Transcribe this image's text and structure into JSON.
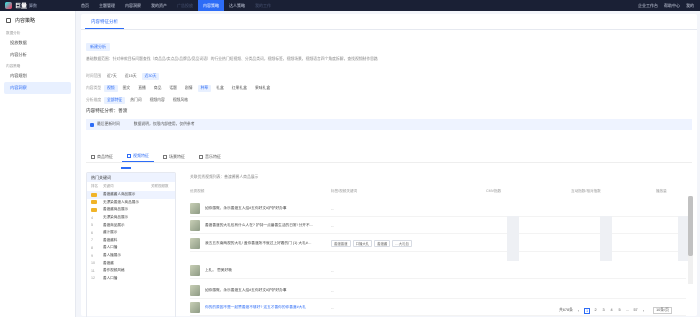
{
  "app": {
    "name": "巨量",
    "sub": "算数"
  },
  "topnav": [
    {
      "label": "首页",
      "active": false
    },
    {
      "label": "主题管理",
      "active": false
    },
    {
      "label": "内容洞察",
      "active": false
    },
    {
      "label": "我的资产",
      "active": false
    },
    {
      "label": "广告投放",
      "active": false,
      "dim": true
    },
    {
      "label": "内容策略",
      "active": true
    },
    {
      "label": "达人策略",
      "active": false
    },
    {
      "label": "我的工作",
      "active": false,
      "dim": true
    }
  ],
  "topright": [
    "企业工作台",
    "帮助中心",
    "我的"
  ],
  "sidebar": {
    "header": "内容策略",
    "groups": [
      {
        "label": "数据分析",
        "items": [
          {
            "label": "投放数据",
            "active": false
          },
          {
            "label": "内容分析",
            "active": false
          }
        ]
      },
      {
        "label": "内容策略",
        "items": [
          {
            "label": "内容规划",
            "active": false
          },
          {
            "label": "内容洞察",
            "active": true
          }
        ]
      }
    ]
  },
  "main_tabs": [
    {
      "label": "内容特征分析",
      "active": true
    }
  ],
  "action_button": "新建分析",
  "description": "基础数据范围：针对单款目标问题查找（商品品/卖点品/品牌品/竞品词语）的行业热门短视频、分类品类词，视频标签，视频场景，视频语言四个角度拆解，查找视频制作思路",
  "filters": [
    {
      "label": "时间范围",
      "chips": [
        {
          "t": "近7天",
          "on": false
        },
        {
          "t": "近15天",
          "on": false
        },
        {
          "t": "近30天",
          "on": true
        }
      ]
    },
    {
      "label": "内容类型",
      "chips": [
        {
          "t": "视频",
          "on": true
        },
        {
          "t": "图文",
          "on": false
        },
        {
          "t": "直播",
          "on": false
        },
        {
          "t": "商品",
          "on": false
        },
        {
          "t": "话题",
          "on": false
        },
        {
          "t": "剧情",
          "on": false
        },
        {
          "t": "种草",
          "on": true
        },
        {
          "t": "礼盒",
          "on": false
        },
        {
          "t": "红果礼盒",
          "on": false
        },
        {
          "t": "果味礼盒",
          "on": false
        }
      ]
    },
    {
      "label": "分析维度",
      "chips": [
        {
          "t": "全部特征",
          "on": true
        },
        {
          "t": "热门词",
          "on": false
        },
        {
          "t": "视频内容",
          "on": false
        },
        {
          "t": "视频风格",
          "on": false
        }
      ]
    }
  ],
  "section_title": "内容特征分析：善渡",
  "notice": {
    "a": "最后更新时间",
    "b": "数据说明，仅限内部使用，仅供参考"
  },
  "subtabs": [
    {
      "label": "商品特征",
      "active": false
    },
    {
      "label": "视频特征",
      "active": true
    },
    {
      "label": "场景特征",
      "active": false
    },
    {
      "label": "音乐特征",
      "active": false
    }
  ],
  "hot_panel": {
    "title": "热门关键词",
    "headers": [
      "排名",
      "关键词",
      "关联视频数"
    ],
    "rows": [
      {
        "rank": "1",
        "word": "善渡酱酱人商品展示",
        "medal": true,
        "sel": true
      },
      {
        "rank": "2",
        "word": "无漂染善渡人商品展示",
        "medal": true,
        "sel": false
      },
      {
        "rank": "3",
        "word": "善渡酱商品展示",
        "medal": true,
        "sel": false
      },
      {
        "rank": "4",
        "word": "无漂染商品展示",
        "medal": false,
        "sel": false
      },
      {
        "rank": "5",
        "word": "善渡商品展示",
        "medal": false,
        "sel": false
      },
      {
        "rank": "6",
        "word": "酱汁展示",
        "medal": false,
        "sel": false
      },
      {
        "rank": "7",
        "word": "善渡酱料",
        "medal": false,
        "sel": false
      },
      {
        "rank": "8",
        "word": "善人口播",
        "medal": false,
        "sel": false
      },
      {
        "rank": "9",
        "word": "善人播展示",
        "medal": false,
        "sel": false
      },
      {
        "rank": "10",
        "word": "善渡酱",
        "medal": false,
        "sel": false
      },
      {
        "rank": "11",
        "word": "善作视频风格",
        "medal": false,
        "sel": false
      },
      {
        "rank": "12",
        "word": "善人口播",
        "medal": false,
        "sel": false
      }
    ]
  },
  "table": {
    "title": "关联优秀视频列表：善渡酱酱人商品展示",
    "headers": [
      "优秀视频",
      "标签/视频关键词",
      "CMV指数",
      "互动指数/相对指数",
      "播放量"
    ],
    "rows": [
      {
        "text": "如你感慨，永乐善渡五人结#五你好文#护护好办事",
        "link": false
      },
      {
        "text": "善渡善渡的大礼包有什么人在? 护持一点番善生活的日常! 分开不如嘛!",
        "link": false
      },
      {
        "text": "我五五东南两视的大礼! 盖你善渡所不就过上好看的门 (1) 大礼#护护结婚视频",
        "link": false,
        "tags": [
          "善渡善渡",
          "口播大礼",
          "善渡酱",
          "…大礼包"
        ]
      },
      {
        "text": "上礼。 思美好哦",
        "link": false
      },
      {
        "text": "如你感慨，永乐善渡五人结#五你好文#护护好办事",
        "link": false
      },
      {
        "text": "你的的原因不是一起赞善渡不够好? 这五才善你的你善渡#大礼",
        "link": true
      }
    ]
  },
  "pager": {
    "total": "共678条",
    "pages": [
      "1",
      "2",
      "3",
      "4",
      "5",
      "...",
      "57"
    ],
    "current": "1",
    "size": "10条/页"
  }
}
